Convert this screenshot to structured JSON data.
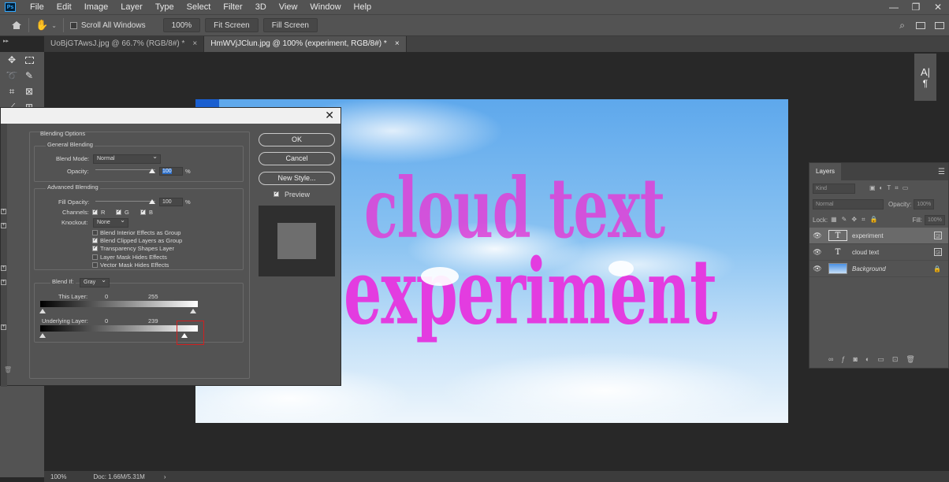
{
  "menu": [
    "File",
    "Edit",
    "Image",
    "Layer",
    "Type",
    "Select",
    "Filter",
    "3D",
    "View",
    "Window",
    "Help"
  ],
  "app_logo": "Ps",
  "window_controls": [
    "—",
    "❐",
    "✕"
  ],
  "options": {
    "scroll_all_label": "Scroll All Windows",
    "zoom_value": "100%",
    "fit_screen": "Fit Screen",
    "fill_screen": "Fill Screen"
  },
  "tabs": [
    {
      "label": "UoBjGTAwsJ.jpg @ 66.7% (RGB/8#) *",
      "close": "×"
    },
    {
      "label": "HmWVjJClun.jpg @ 100% (experiment, RGB/8#) *",
      "close": "×"
    }
  ],
  "canvas": {
    "line1": "cloud text",
    "line2": "experiment"
  },
  "status": {
    "zoom": "100%",
    "doc": "Doc: 1.66M/5.31M"
  },
  "layers_panel": {
    "tab": "Layers",
    "kind_placeholder": "Kind",
    "blend_mode": "Normal",
    "opacity_label": "Opacity:",
    "opacity_value": "100%",
    "lock_label": "Lock:",
    "fill_label": "Fill:",
    "fill_value": "100%",
    "layers": [
      {
        "name": "experiment",
        "type": "text",
        "selected": true
      },
      {
        "name": "cloud text",
        "type": "text",
        "selected": false
      },
      {
        "name": "Background",
        "type": "image",
        "selected": false
      }
    ]
  },
  "dialog": {
    "blending_options": "Blending Options",
    "general_blending": "General Blending",
    "blend_mode_label": "Blend Mode:",
    "blend_mode_value": "Normal",
    "opacity_label": "Opacity:",
    "opacity_value": "100",
    "percent": "%",
    "advanced_blending": "Advanced Blending",
    "fill_opacity_label": "Fill Opacity:",
    "fill_opacity_value": "100",
    "channels_label": "Channels:",
    "channel_r": "R",
    "channel_g": "G",
    "channel_b": "B",
    "knockout_label": "Knockout:",
    "knockout_value": "None",
    "checks": [
      {
        "label": "Blend Interior Effects as Group",
        "checked": false
      },
      {
        "label": "Blend Clipped Layers as Group",
        "checked": true
      },
      {
        "label": "Transparency Shapes Layer",
        "checked": true
      },
      {
        "label": "Layer Mask Hides Effects",
        "checked": false
      },
      {
        "label": "Vector Mask Hides Effects",
        "checked": false
      }
    ],
    "blend_if_label": "Blend If:",
    "blend_if_value": "Gray",
    "this_layer_label": "This Layer:",
    "this_layer_low": "0",
    "this_layer_high": "255",
    "underlying_label": "Underlying Layer:",
    "underlying_low": "0",
    "underlying_high": "239",
    "ok": "OK",
    "cancel": "Cancel",
    "new_style": "New Style...",
    "preview": "Preview"
  }
}
